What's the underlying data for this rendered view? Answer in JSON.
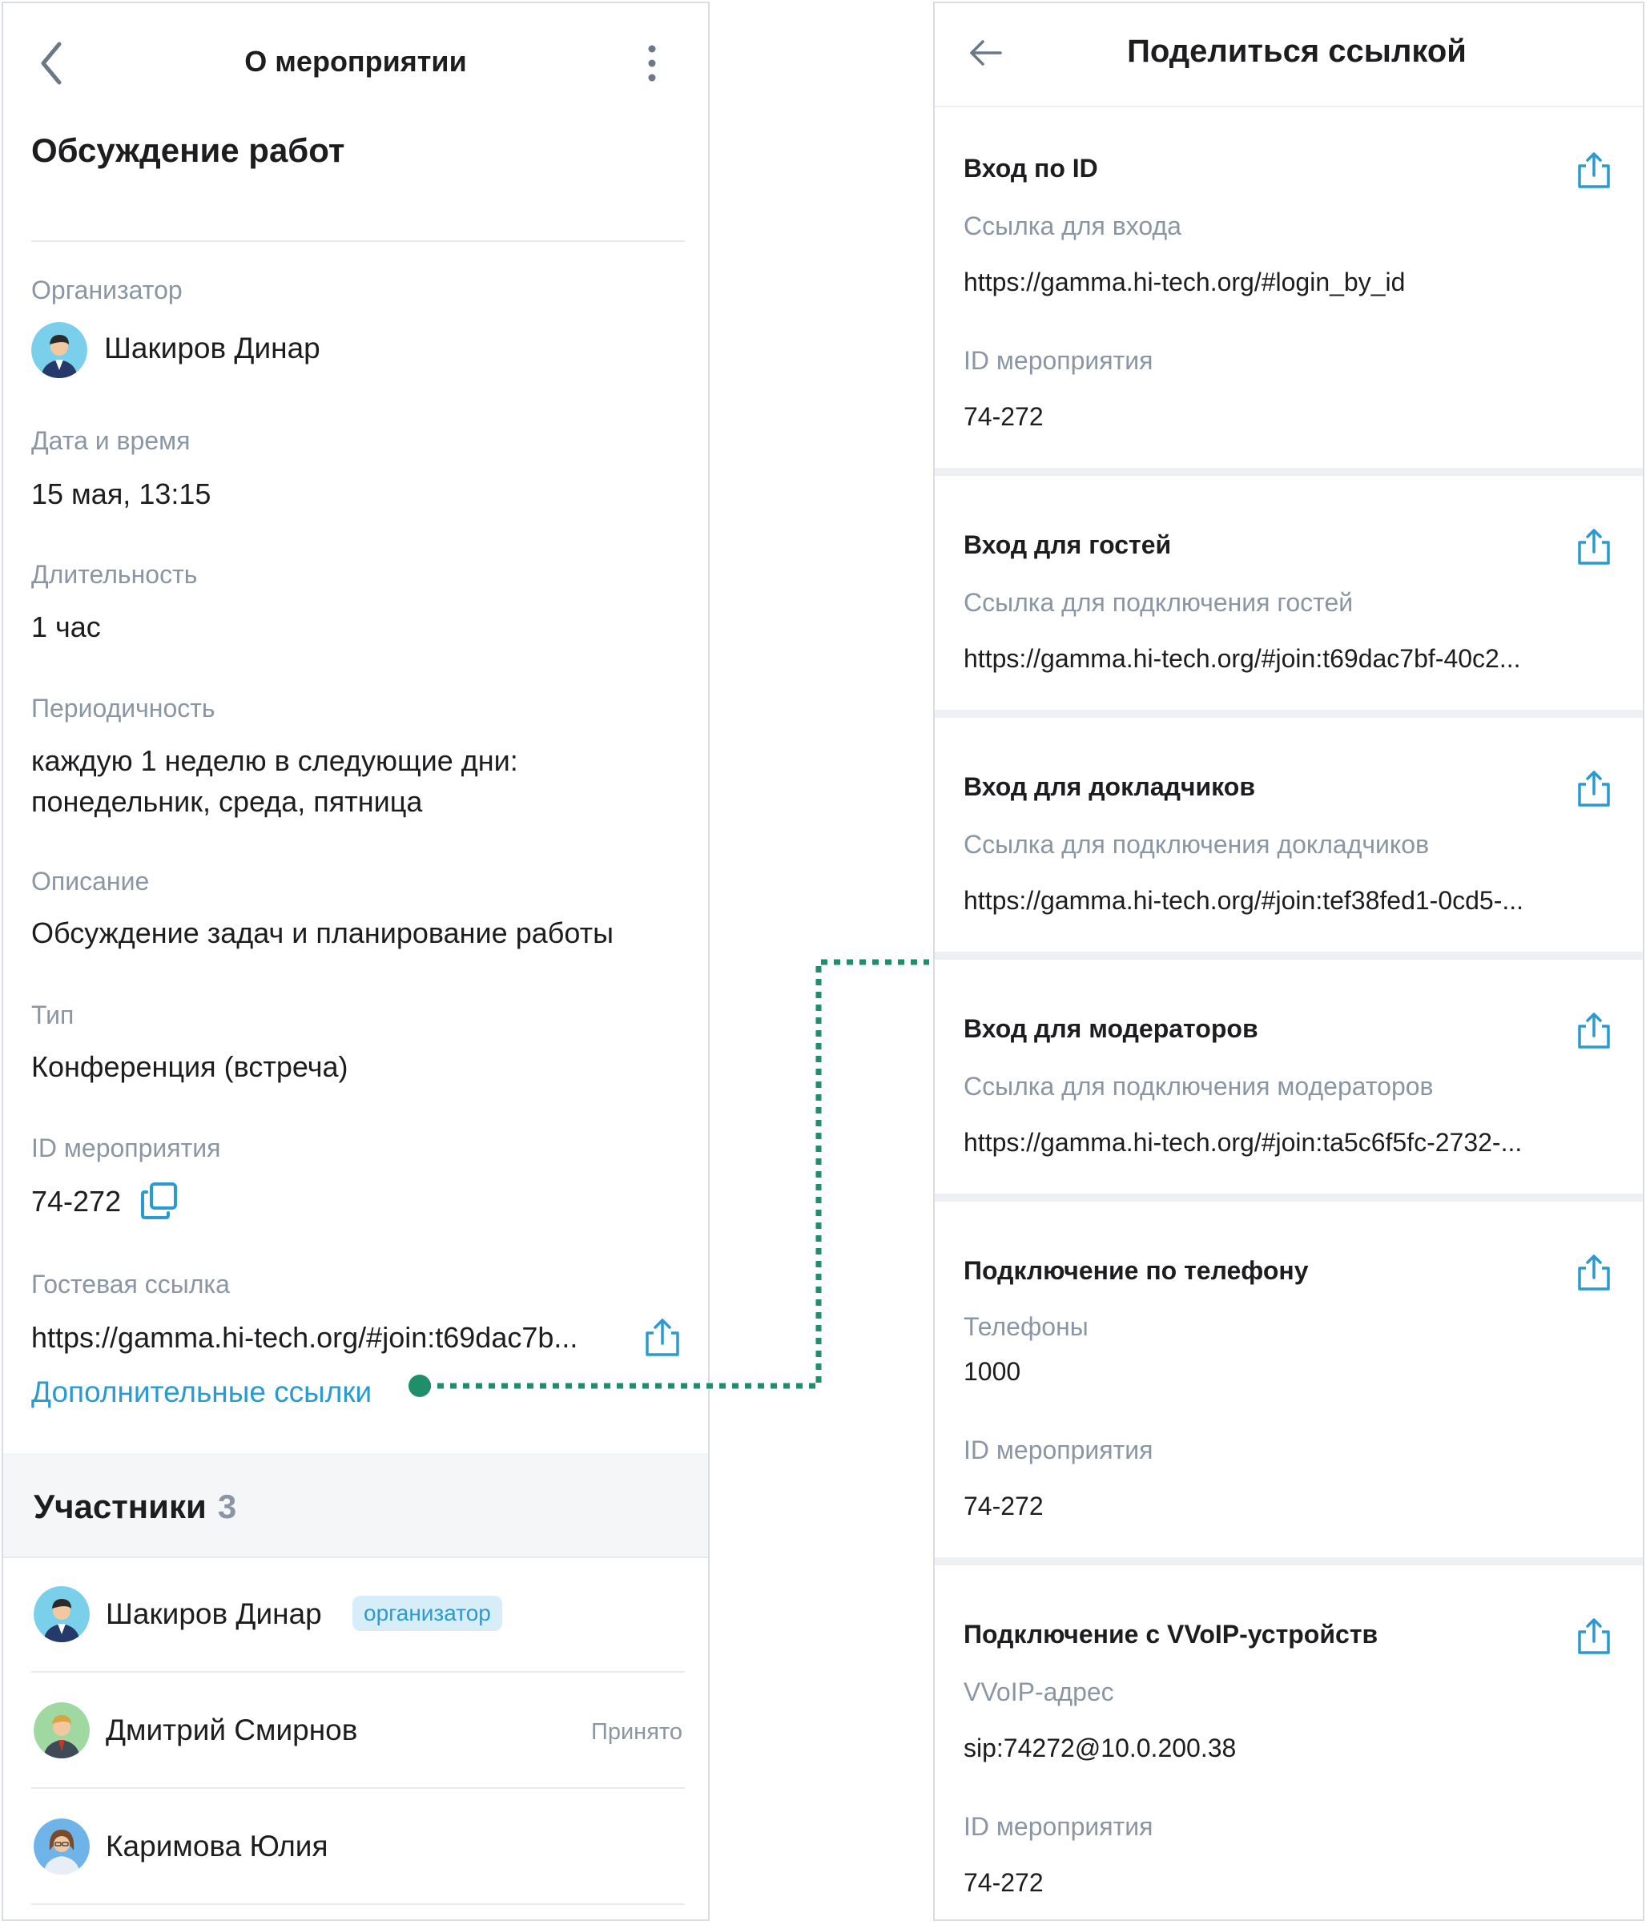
{
  "event": {
    "header_title": "О мероприятии",
    "title": "Обсуждение работ",
    "organizer_label": "Организатор",
    "organizer_name": "Шакиров Динар",
    "datetime_label": "Дата и время",
    "datetime_value": "15 мая, 13:15",
    "duration_label": "Длительность",
    "duration_value": "1 час",
    "recurrence_label": "Периодичность",
    "recurrence_line1": "каждую 1 неделю в следующие дни:",
    "recurrence_line2": "понедельник, среда, пятница",
    "description_label": "Описание",
    "description_value": "Обсуждение задач и планирование работы",
    "type_label": "Тип",
    "type_value": "Конференция (встреча)",
    "id_label": "ID мероприятия",
    "id_value": "74-272",
    "guest_link_label": "Гостевая ссылка",
    "guest_link_value": "https://gamma.hi-tech.org/#join:t69dac7b...",
    "more_links": "Дополнительные ссылки"
  },
  "participants": {
    "title": "Участники",
    "count": "3",
    "items": [
      {
        "name": "Шакиров Динар",
        "badge": "организатор",
        "status": ""
      },
      {
        "name": "Дмитрий Смирнов",
        "badge": "",
        "status": "Принято"
      },
      {
        "name": "Каримова Юлия",
        "badge": "",
        "status": ""
      }
    ]
  },
  "share": {
    "title": "Поделиться ссылкой",
    "sections": [
      {
        "title": "Вход по ID",
        "label": "Ссылка для входа",
        "value": "https://gamma.hi-tech.org/#login_by_id",
        "label2": "ID мероприятия",
        "value2": "74-272"
      },
      {
        "title": "Вход для гостей",
        "label": "Ссылка для подключения гостей",
        "value": "https://gamma.hi-tech.org/#join:t69dac7bf-40c2..."
      },
      {
        "title": "Вход для докладчиков",
        "label": "Ссылка для подключения докладчиков",
        "value": "https://gamma.hi-tech.org/#join:tef38fed1-0cd5-..."
      },
      {
        "title": "Вход для модераторов",
        "label": "Ссылка для подключения модераторов",
        "value": "https://gamma.hi-tech.org/#join:ta5c6f5fc-2732-..."
      },
      {
        "title": "Подключение по телефону",
        "label": "Телефоны",
        "value": "1000",
        "label2": "ID мероприятия",
        "value2": "74-272"
      },
      {
        "title": "Подключение с VVoIP-устройств",
        "label": "VVoIP-адрес",
        "value": "sip:74272@10.0.200.38",
        "label2": "ID мероприятия",
        "value2": "74-272"
      }
    ]
  },
  "colors": {
    "accent": "#2a9bd1",
    "connector": "#1f8f6a",
    "muted": "#8a96a3"
  },
  "icons": [
    "back-chevron-icon",
    "more-vertical-icon",
    "copy-icon",
    "share-icon",
    "back-arrow-icon",
    "avatar-icon"
  ]
}
